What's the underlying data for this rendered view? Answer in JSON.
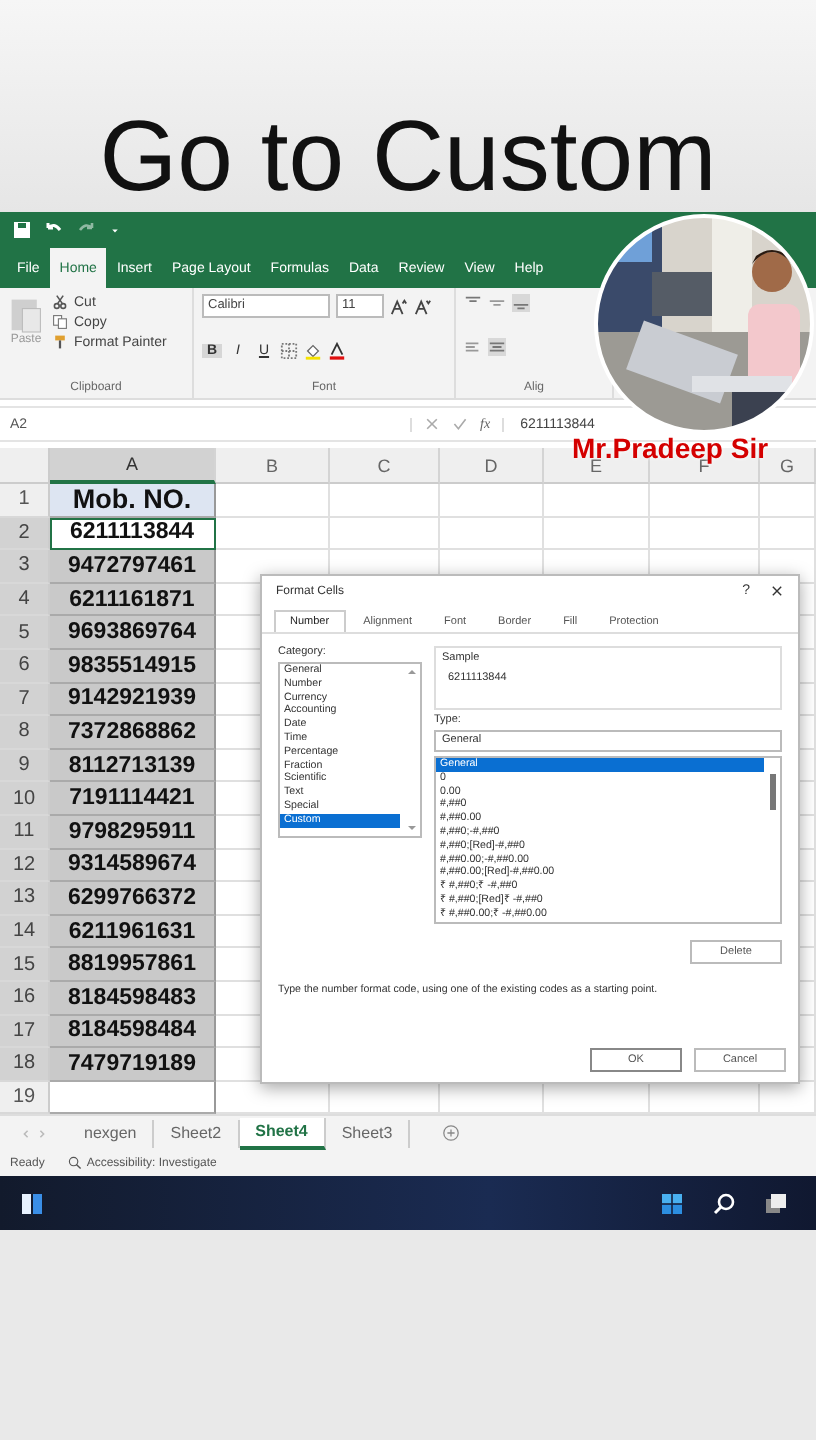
{
  "headline": "Go to Custom",
  "ribbon_tabs": [
    {
      "label": "File",
      "selected": false
    },
    {
      "label": "Home",
      "selected": true
    },
    {
      "label": "Insert",
      "selected": false
    },
    {
      "label": "Page Layout",
      "selected": false
    },
    {
      "label": "Formulas",
      "selected": false
    },
    {
      "label": "Data",
      "selected": false
    },
    {
      "label": "Review",
      "selected": false
    },
    {
      "label": "View",
      "selected": false
    },
    {
      "label": "Help",
      "selected": false
    }
  ],
  "clipboard": {
    "paste": "Paste",
    "cut": "Cut",
    "copy": "Copy",
    "format_painter": "Format Painter",
    "label": "Clipboard"
  },
  "font": {
    "name": "Calibri",
    "size": "11",
    "bold": "B",
    "italic": "I",
    "underline": "U",
    "label": "Font"
  },
  "alignment_label": "Alig",
  "formula_bar": {
    "name_box": "A2",
    "fx": "fx",
    "value": "6211113844"
  },
  "columns": [
    {
      "label": "A",
      "selected": true
    },
    {
      "label": "B",
      "selected": false
    },
    {
      "label": "C",
      "selected": false
    },
    {
      "label": "D",
      "selected": false
    },
    {
      "label": "E",
      "selected": false
    },
    {
      "label": "F",
      "selected": false
    },
    {
      "label": "G",
      "selected": false
    }
  ],
  "rows": [
    {
      "number": "1",
      "value": "Mob. NO.",
      "kind": "heading",
      "selected": false,
      "active": false
    },
    {
      "number": "2",
      "value": "6211113844",
      "kind": "data",
      "selected": true,
      "active": true
    },
    {
      "number": "3",
      "value": "9472797461",
      "kind": "data",
      "selected": true,
      "active": false
    },
    {
      "number": "4",
      "value": "6211161871",
      "kind": "data",
      "selected": true,
      "active": false
    },
    {
      "number": "5",
      "value": "9693869764",
      "kind": "data",
      "selected": true,
      "active": false
    },
    {
      "number": "6",
      "value": "9835514915",
      "kind": "data",
      "selected": true,
      "active": false
    },
    {
      "number": "7",
      "value": "9142921939",
      "kind": "data",
      "selected": true,
      "active": false
    },
    {
      "number": "8",
      "value": "7372868862",
      "kind": "data",
      "selected": true,
      "active": false
    },
    {
      "number": "9",
      "value": "8112713139",
      "kind": "data",
      "selected": true,
      "active": false
    },
    {
      "number": "10",
      "value": "7191114421",
      "kind": "data",
      "selected": true,
      "active": false
    },
    {
      "number": "11",
      "value": "9798295911",
      "kind": "data",
      "selected": true,
      "active": false
    },
    {
      "number": "12",
      "value": "9314589674",
      "kind": "data",
      "selected": true,
      "active": false
    },
    {
      "number": "13",
      "value": "6299766372",
      "kind": "data",
      "selected": true,
      "active": false
    },
    {
      "number": "14",
      "value": "6211961631",
      "kind": "data",
      "selected": true,
      "active": false
    },
    {
      "number": "15",
      "value": "8819957861",
      "kind": "data",
      "selected": true,
      "active": false
    },
    {
      "number": "16",
      "value": "8184598483",
      "kind": "data",
      "selected": true,
      "active": false
    },
    {
      "number": "17",
      "value": "8184598484",
      "kind": "data",
      "selected": true,
      "active": false
    },
    {
      "number": "18",
      "value": "7479719189",
      "kind": "data",
      "selected": true,
      "active": false
    },
    {
      "number": "19",
      "kind": "data",
      "selected": false,
      "active": false
    }
  ],
  "sheet_tabs": [
    {
      "label": "nexgen",
      "selected": false
    },
    {
      "label": "Sheet2",
      "selected": false
    },
    {
      "label": "Sheet4",
      "selected": true
    },
    {
      "label": "Sheet3",
      "selected": false
    }
  ],
  "status": {
    "ready": "Ready",
    "accessibility": "Accessibility: Investigate"
  },
  "dialog": {
    "title": "Format Cells",
    "help": "?",
    "tabs": [
      {
        "label": "Number",
        "selected": true
      },
      {
        "label": "Alignment",
        "selected": false
      },
      {
        "label": "Font",
        "selected": false
      },
      {
        "label": "Border",
        "selected": false
      },
      {
        "label": "Fill",
        "selected": false
      },
      {
        "label": "Protection",
        "selected": false
      }
    ],
    "category_label": "Category:",
    "categories": [
      {
        "label": "General",
        "selected": false
      },
      {
        "label": "Number",
        "selected": false
      },
      {
        "label": "Currency",
        "selected": false
      },
      {
        "label": "Accounting",
        "selected": false
      },
      {
        "label": "Date",
        "selected": false
      },
      {
        "label": "Time",
        "selected": false
      },
      {
        "label": "Percentage",
        "selected": false
      },
      {
        "label": "Fraction",
        "selected": false
      },
      {
        "label": "Scientific",
        "selected": false
      },
      {
        "label": "Text",
        "selected": false
      },
      {
        "label": "Special",
        "selected": false
      },
      {
        "label": "Custom",
        "selected": true
      }
    ],
    "sample_label": "Sample",
    "sample_value": "6211113844",
    "type_label": "Type:",
    "type_value": "General",
    "type_list": [
      {
        "label": "General",
        "selected": true
      },
      {
        "label": "0",
        "selected": false
      },
      {
        "label": "0.00",
        "selected": false
      },
      {
        "label": "#,##0",
        "selected": false
      },
      {
        "label": "#,##0.00",
        "selected": false
      },
      {
        "label": "#,##0;-#,##0",
        "selected": false
      },
      {
        "label": "#,##0;[Red]-#,##0",
        "selected": false
      },
      {
        "label": "#,##0.00;-#,##0.00",
        "selected": false
      },
      {
        "label": "#,##0.00;[Red]-#,##0.00",
        "selected": false
      },
      {
        "label": "₹ #,##0;₹ -#,##0",
        "selected": false
      },
      {
        "label": "₹ #,##0;[Red]₹ -#,##0",
        "selected": false
      },
      {
        "label": "₹ #,##0.00;₹ -#,##0.00",
        "selected": false
      }
    ],
    "delete": "Delete",
    "description": "Type the number format code, using one of the existing codes as a starting point.",
    "ok": "OK",
    "cancel": "Cancel"
  },
  "presenter": {
    "name": "Mr.Pradeep Sir"
  }
}
